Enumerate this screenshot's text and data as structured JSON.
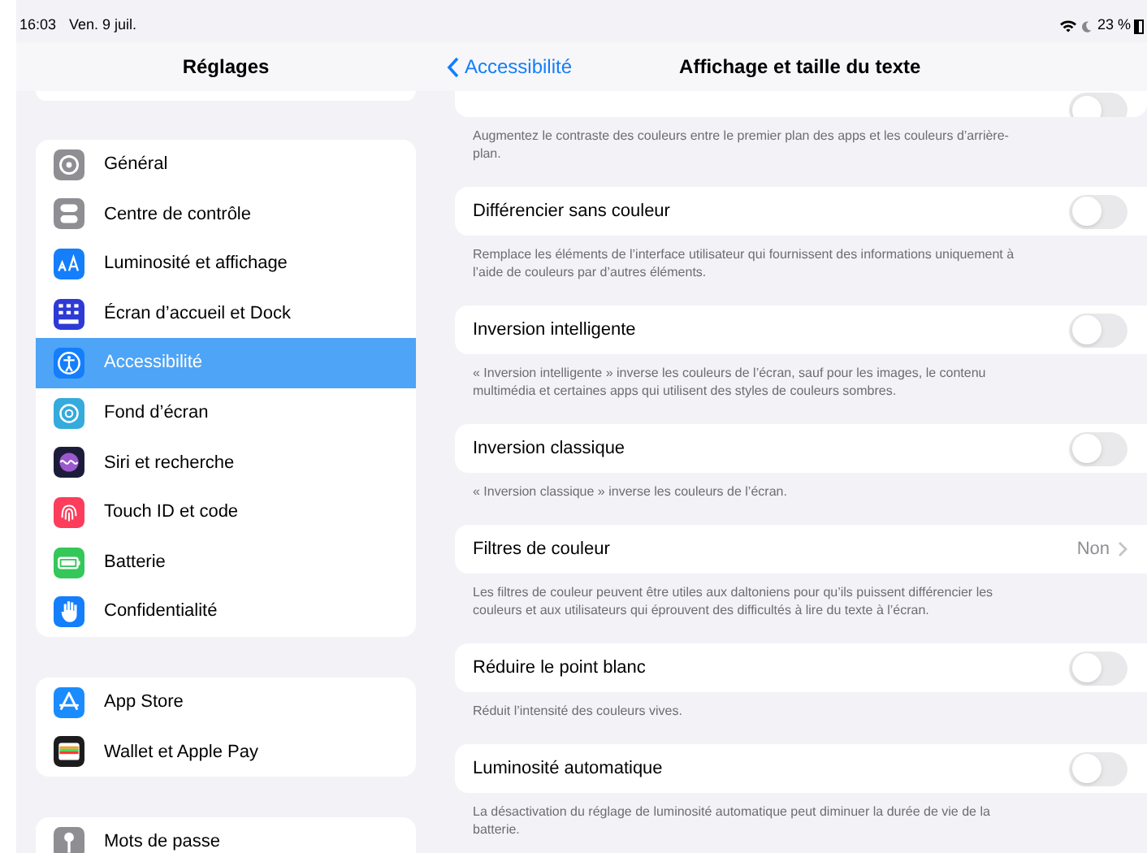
{
  "status_bar": {
    "time": "16:03",
    "date": "Ven. 9 juil.",
    "battery": "23 %"
  },
  "sidebar": {
    "title": "Réglages",
    "groups": [
      {
        "items": [
          {
            "label": "Général",
            "kind": "gear",
            "color": "#8e8e93",
            "selected": false
          },
          {
            "label": "Centre de contrôle",
            "kind": "switches",
            "color": "#8e8e93",
            "selected": false
          },
          {
            "label": "Luminosité et affichage",
            "kind": "text-size",
            "color": "#147efb",
            "selected": false
          },
          {
            "label": "Écran d’accueil et Dock",
            "kind": "grid",
            "color": "#2d3ad6",
            "selected": false
          },
          {
            "label": "Accessibilité",
            "kind": "person",
            "color": "#147efb",
            "selected": true
          },
          {
            "label": "Fond d’écran",
            "kind": "flower",
            "color": "#35aadc",
            "selected": false
          },
          {
            "label": "Siri et recherche",
            "kind": "siri",
            "color": "#1c1c3a",
            "selected": false
          },
          {
            "label": "Touch ID et code",
            "kind": "fingerprint",
            "color": "#fc3d5b",
            "selected": false
          },
          {
            "label": "Batterie",
            "kind": "battery",
            "color": "#34c759",
            "selected": false
          },
          {
            "label": "Confidentialité",
            "kind": "hand",
            "color": "#147efb",
            "selected": false
          }
        ]
      },
      {
        "items": [
          {
            "label": "App Store",
            "kind": "appstore",
            "color": "#1a8cff",
            "selected": false
          },
          {
            "label": "Wallet et Apple Pay",
            "kind": "wallet",
            "color": "#1c1c1e",
            "selected": false
          }
        ]
      },
      {
        "items": [
          {
            "label": "Mots de passe",
            "kind": "key",
            "color": "#8e8e93",
            "selected": false
          }
        ]
      }
    ]
  },
  "detail": {
    "back": "Accessibilité",
    "title": "Affichage et taille du texte",
    "rows": [
      {
        "kind": "toggle",
        "on": false,
        "footer": "Augmentez le contraste des couleurs entre le premier plan des apps et les couleurs d’arrière-plan."
      },
      {
        "kind": "toggle",
        "label": "Différencier sans couleur",
        "on": false,
        "footer": "Remplace les éléments de l’interface utilisateur qui fournissent des informations uniquement à l’aide de couleurs par d’autres éléments."
      },
      {
        "kind": "toggle",
        "label": "Inversion intelligente",
        "on": false,
        "footer": "« Inversion intelligente » inverse les couleurs de l’écran, sauf pour les images, le contenu multimédia et certaines apps qui utilisent des styles de couleurs sombres."
      },
      {
        "kind": "toggle",
        "label": "Inversion classique",
        "on": false,
        "footer": "« Inversion classique » inverse les couleurs de l’écran."
      },
      {
        "kind": "link",
        "label": "Filtres de couleur",
        "value": "Non",
        "footer": "Les filtres de couleur peuvent être utiles aux daltoniens pour qu’ils puissent différencier les couleurs et aux utilisateurs qui éprouvent des difficultés à lire du texte à l’écran."
      },
      {
        "kind": "toggle",
        "label": "Réduire le point blanc",
        "on": false,
        "footer": "Réduit l’intensité des couleurs vives."
      },
      {
        "kind": "toggle",
        "label": "Luminosité automatique",
        "on": false,
        "footer": "La désactivation du réglage de luminosité automatique peut diminuer la durée de vie de la batterie."
      }
    ]
  }
}
